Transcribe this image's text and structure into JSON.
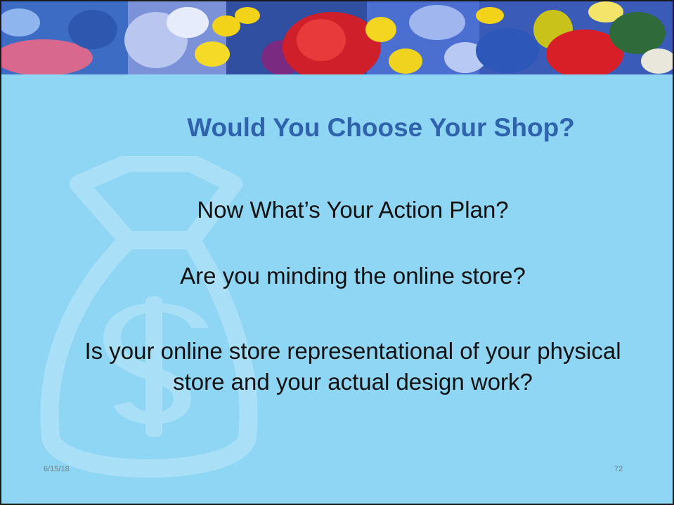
{
  "slide": {
    "title": "Would You Choose Your Shop?",
    "line1": "Now What’s Your Action Plan?",
    "line2": "Are you minding the online store?",
    "line3": "Is your online store representational of your physical store and your actual design work?",
    "date": "6/15/18",
    "page_number": "72"
  },
  "colors": {
    "background": "#8fd6f4",
    "title": "#2f63ad",
    "body_text": "#111111",
    "footer_text": "#6e7f89"
  },
  "images": {
    "header": "flower-photo-banner",
    "watermark": "money-bag-dollar-icon"
  }
}
